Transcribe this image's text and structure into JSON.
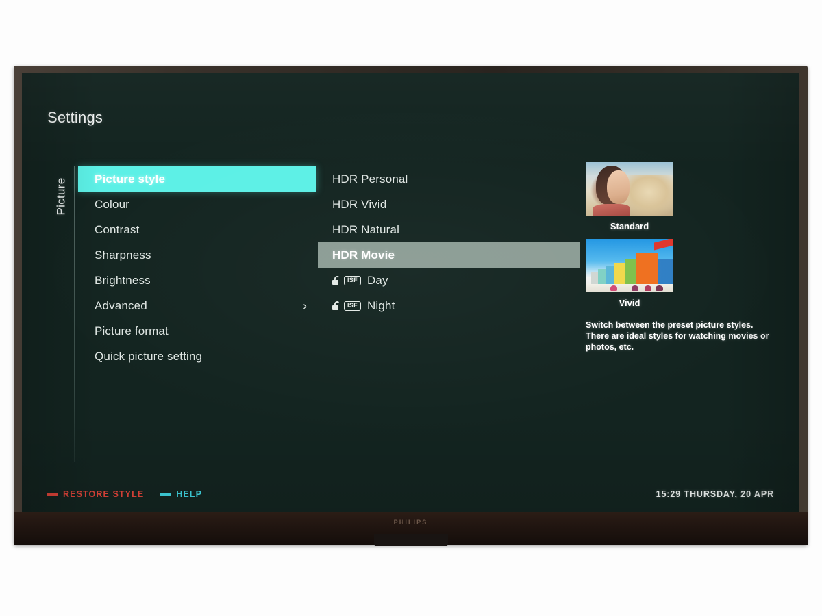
{
  "device": {
    "brand": "PHILIPS"
  },
  "osd": {
    "title": "Settings",
    "category_tab": "Picture",
    "settings_menu": [
      {
        "label": "Picture style",
        "active": true,
        "chevron": ""
      },
      {
        "label": "Colour",
        "active": false,
        "chevron": ""
      },
      {
        "label": "Contrast",
        "active": false,
        "chevron": ""
      },
      {
        "label": "Sharpness",
        "active": false,
        "chevron": ""
      },
      {
        "label": "Brightness",
        "active": false,
        "chevron": ""
      },
      {
        "label": "Advanced",
        "active": false,
        "chevron": "›"
      },
      {
        "label": "Picture format",
        "active": false,
        "chevron": ""
      },
      {
        "label": "Quick picture setting",
        "active": false,
        "chevron": ""
      }
    ],
    "style_options": [
      {
        "label": "HDR Personal",
        "selected": false,
        "locked": false,
        "badge": ""
      },
      {
        "label": "HDR Vivid",
        "selected": false,
        "locked": false,
        "badge": ""
      },
      {
        "label": "HDR Natural",
        "selected": false,
        "locked": false,
        "badge": ""
      },
      {
        "label": "HDR Movie",
        "selected": true,
        "locked": false,
        "badge": ""
      },
      {
        "label": "Day",
        "selected": false,
        "locked": true,
        "badge": "ISF"
      },
      {
        "label": "Night",
        "selected": false,
        "locked": true,
        "badge": "ISF"
      }
    ],
    "preview": {
      "thumbnails": [
        {
          "caption": "Standard",
          "image": "portrait-photo-thumbnail"
        },
        {
          "caption": "Vivid",
          "image": "beach-huts-photo-thumbnail"
        }
      ],
      "description": "Switch between the preset picture styles. There are ideal styles for watching movies or photos, etc."
    },
    "footer": {
      "actions": [
        {
          "label": "RESTORE STYLE",
          "key_colour": "#e2453a"
        },
        {
          "label": "HELP",
          "key_colour": "#3fd4e0"
        }
      ],
      "clock": "15:29 THURSDAY, 20 APR"
    }
  },
  "colours": {
    "screen_background": "#132420",
    "active_highlight": "#5cf0e6",
    "selected_row": "#8b9c94",
    "text_primary": "#dfe6e3",
    "red_key": "#e2453a",
    "cyan_key": "#3fd4e0"
  }
}
